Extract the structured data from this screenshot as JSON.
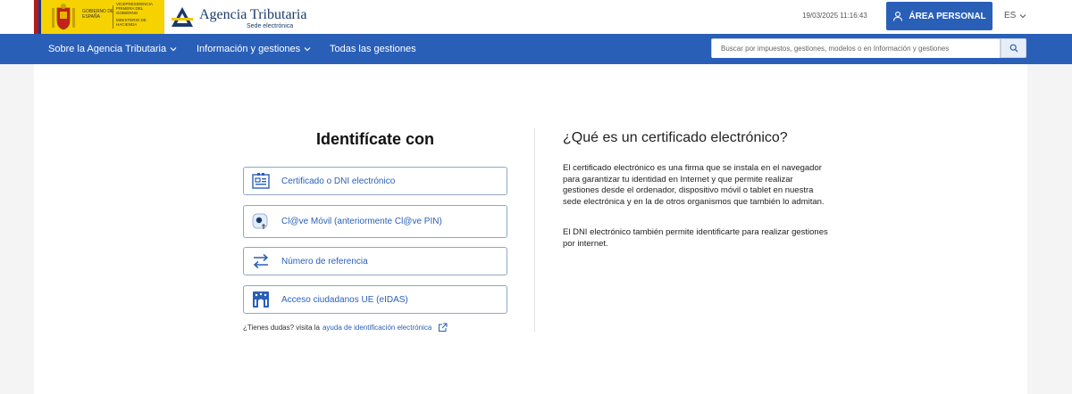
{
  "header": {
    "gov_text_1": "GOBIERNO DE ESPAÑA",
    "gov_text_2": "VICEPRESIDENCIA PRIMERA DEL GOBIERNO",
    "gov_text_3": "MINISTERIO DE HACIENDA",
    "agency_name": "Agencia Tributaria",
    "agency_sub": "Sede electrónica",
    "datetime": "19/03/2025 11:16:43",
    "area_personal_label": "ÁREA PERSONAL",
    "language": "ES"
  },
  "nav": {
    "items": [
      {
        "label": "Sobre la Agencia Tributaria",
        "dropdown": true
      },
      {
        "label": "Información y gestiones",
        "dropdown": true
      },
      {
        "label": "Todas las gestiones",
        "dropdown": false
      }
    ],
    "search_placeholder": "Buscar por impuestos, gestiones, modelos o en Información y gestiones"
  },
  "identify": {
    "title": "Identifícate con",
    "options": [
      {
        "label": "Certificado o DNI electrónico",
        "icon": "certificate-icon"
      },
      {
        "label": "Cl@ve Móvil (anteriormente Cl@ve PIN)",
        "icon": "clave-movil-icon"
      },
      {
        "label": "Número de referencia",
        "icon": "exchange-arrows-icon"
      },
      {
        "label": "Acceso ciudadanos UE (eIDAS)",
        "icon": "eu-building-icon"
      }
    ],
    "help_prefix": "¿Tienes dudas? visita la",
    "help_link": "ayuda de identificación electrónica"
  },
  "info": {
    "title": "¿Qué es un certificado electrónico?",
    "paragraph_1": "El certificado electrónico es una firma que se instala en el navegador para garantizar tu identidad en Internet y que permite realizar gestiones desde el ordenador, dispositivo móvil o tablet en nuestra sede electrónica y en la de otros organismos que también lo admitan.",
    "paragraph_2": "El DNI electrónico también permite identificarte para realizar gestiones por internet."
  },
  "colors": {
    "primary": "#2a5fb8",
    "gov_yellow": "#f6d200"
  }
}
